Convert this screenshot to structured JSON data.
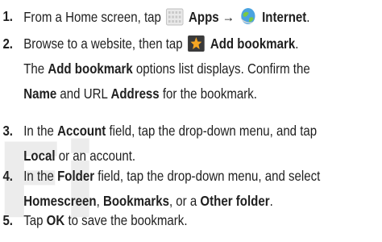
{
  "watermark": "Fi",
  "steps": [
    {
      "number": "1.",
      "segments": [
        "From a Home screen, tap ",
        "Apps",
        " → ",
        "Internet",
        "."
      ],
      "icons": [
        "apps-grid-icon",
        "internet-globe-icon"
      ]
    },
    {
      "number": "2.",
      "segments": [
        "Browse to a website, then tap ",
        "Add bookmark",
        "."
      ],
      "icons": [
        "add-bookmark-star-icon"
      ],
      "note_lines": [
        [
          "The ",
          "Add bookmark",
          " options list displays. Confirm the"
        ],
        [
          "Name",
          " and URL ",
          "Address",
          " for the bookmark."
        ]
      ]
    },
    {
      "number": "3.",
      "lines": [
        [
          "In the ",
          "Account",
          " field, tap the drop-down menu, and tap"
        ],
        [
          "Local",
          " or an account."
        ]
      ]
    },
    {
      "number": "4.",
      "lines": [
        [
          "In the ",
          "Folder",
          " field, tap the drop-down menu, and select"
        ],
        [
          "Homescreen",
          ", ",
          "Bookmarks",
          ", or a ",
          "Other folder",
          "."
        ]
      ]
    },
    {
      "number": "5.",
      "segments": [
        "Tap ",
        "OK",
        " to save the bookmark."
      ]
    }
  ]
}
